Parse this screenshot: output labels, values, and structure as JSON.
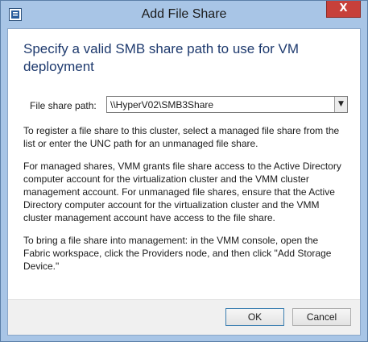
{
  "window": {
    "title": "Add File Share",
    "close_symbol": "X",
    "app_icon": "window-icon"
  },
  "heading": "Specify a valid SMB share path to use for VM deployment",
  "file_share": {
    "label": "File share path:",
    "value": "\\\\HyperV02\\SMB3Share",
    "dropdown_icon": "chevron-down-icon"
  },
  "paragraphs": [
    "To register a file share to this cluster, select a managed file share from the list or enter the UNC path for an unmanaged file share.",
    "For managed shares, VMM grants file share access to the Active Directory computer account for the virtualization cluster and the VMM cluster management account. For unmanaged file shares, ensure that the Active Directory computer account for the virtualization cluster and the VMM cluster management account have access to the file share.",
    "To bring a file share into management: in the VMM console, open the Fabric workspace, click the Providers node, and then click \"Add Storage Device.\""
  ],
  "buttons": {
    "ok": "OK",
    "cancel": "Cancel"
  },
  "colors": {
    "frame": "#a8c5e6",
    "heading": "#1e3a6e",
    "close": "#c7403a"
  }
}
